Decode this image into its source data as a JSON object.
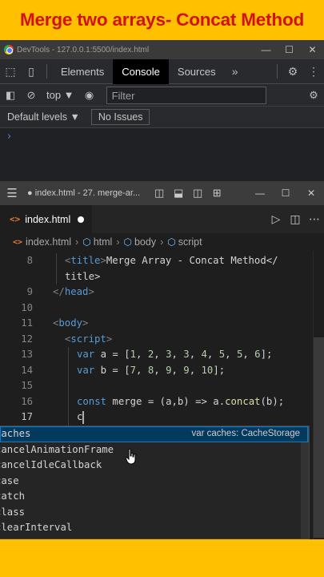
{
  "banner": {
    "title": "Merge two arrays- Concat Method"
  },
  "devtools": {
    "window_title": "DevTools - 127.0.0.1:5500/index.html",
    "tabs": [
      "Elements",
      "Console",
      "Sources"
    ],
    "active_tab": "Console",
    "more_tabs": "»",
    "context": "top ▼",
    "filter_placeholder": "Filter",
    "levels": "Default levels ▼",
    "issues": "No Issues",
    "prompt": "›"
  },
  "vscode": {
    "window_title": "● index.html - 27. merge-ar...",
    "tab_label": "index.html",
    "breadcrumb": [
      "index.html",
      "html",
      "body",
      "script"
    ],
    "lines": [
      {
        "num": "8",
        "text": "<title>Merge Array - Concat Method</"
      },
      {
        "num": "",
        "text": "title>"
      },
      {
        "num": "9",
        "text": "</head>"
      },
      {
        "num": "10",
        "text": ""
      },
      {
        "num": "11",
        "text": "<body>"
      },
      {
        "num": "12",
        "text": "<script>"
      },
      {
        "num": "13",
        "text": "var a = [1, 2, 3, 3, 4, 5, 5, 6];"
      },
      {
        "num": "14",
        "text": "var b = [7, 8, 9, 9, 10];"
      },
      {
        "num": "15",
        "text": ""
      },
      {
        "num": "16",
        "text": "const merge = (a,b) => a.concat(b);"
      },
      {
        "num": "17",
        "text": "c"
      }
    ],
    "suggestions": [
      {
        "label": "caches",
        "detail": "var caches: CacheStorage"
      },
      {
        "label": "cancelAnimationFrame",
        "detail": ""
      },
      {
        "label": "cancelIdleCallback",
        "detail": ""
      },
      {
        "label": "case",
        "detail": ""
      },
      {
        "label": "catch",
        "detail": ""
      },
      {
        "label": "class",
        "detail": ""
      },
      {
        "label": "clearInterval",
        "detail": ""
      }
    ]
  },
  "colors": {
    "banner_bg": "#ffc000",
    "banner_text": "#d41111",
    "editor_bg": "#1e1e1e",
    "suggest_selected": "#04395e"
  }
}
